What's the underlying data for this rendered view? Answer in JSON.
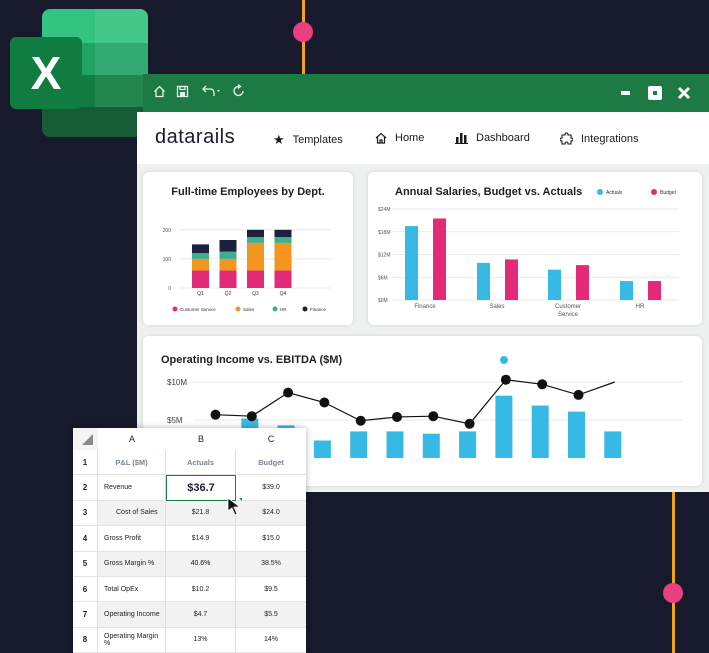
{
  "colors": {
    "background": "#171a2b",
    "accent_orange": "#f0a11f",
    "accent_pink": "#e83e82",
    "excel_green": "#1d7a45",
    "actuals_blue": "#36b9e4",
    "budget_pink": "#e22a78"
  },
  "excel_logo": {
    "letter": "X"
  },
  "window": {
    "icons": [
      "home-icon",
      "save-icon",
      "undo-icon",
      "refresh-icon",
      "minimize-icon",
      "restore-icon",
      "close-icon"
    ]
  },
  "nav": {
    "brand": "datarails",
    "templates": "Templates",
    "home": "Home",
    "dashboard": "Dashboard",
    "integrations": "Integrations"
  },
  "chart_data": [
    {
      "type": "bar",
      "stacked": true,
      "title": "Full-time Employees by Dept.",
      "categories": [
        "Q1",
        "Q2",
        "Q3",
        "Q4"
      ],
      "yticks": [
        "200",
        "100",
        "0"
      ],
      "ylim": [
        0,
        220
      ],
      "series": [
        {
          "name": "Customer Service",
          "color": "#e22a78",
          "values": [
            60,
            60,
            60,
            60
          ]
        },
        {
          "name": "Sales",
          "color": "#f3951f",
          "values": [
            40,
            40,
            95,
            95
          ]
        },
        {
          "name": "HR",
          "color": "#3fae8c",
          "values": [
            20,
            25,
            20,
            20
          ]
        },
        {
          "name": "Finance",
          "color": "#1c2140",
          "values": [
            30,
            40,
            25,
            25
          ]
        }
      ]
    },
    {
      "type": "bar",
      "title": "Annual Salaries, Budget vs. Actuals",
      "categories": [
        "Finance",
        "Sales",
        "Customer Service",
        "HR"
      ],
      "yticks": [
        "$24M",
        "$18M",
        "$12M",
        "$6M",
        "$0M"
      ],
      "ylim": [
        0,
        24
      ],
      "series": [
        {
          "name": "Actuals",
          "color": "#36b9e4",
          "values": [
            19.5,
            9.8,
            8,
            5
          ]
        },
        {
          "name": "Budget",
          "color": "#e22a78",
          "values": [
            21.5,
            10.7,
            9.2,
            5
          ]
        }
      ]
    },
    {
      "type": "bar+line",
      "title": "Operating Income vs. EBITDA ($M)",
      "yticks": [
        "$10M",
        "$5M"
      ],
      "ylim": [
        0,
        11
      ],
      "bars": [
        2.6,
        5.2,
        4.3,
        2.3,
        3.5,
        3.5,
        3.2,
        3.5,
        8.2,
        6.9,
        6.1,
        3.5
      ],
      "line": [
        5.7,
        5.5,
        8.6,
        7.3,
        4.9,
        5.4,
        5.5,
        4.5,
        10.3,
        9.7,
        8.3,
        10
      ]
    }
  ],
  "sheet": {
    "columns": [
      "A",
      "B",
      "C"
    ],
    "header": {
      "row": "1",
      "label": "P&L ($M)",
      "actuals": "Actuals",
      "budget": "Budget"
    },
    "rows": [
      {
        "num": "2",
        "label": "Revenue",
        "actuals": "$36.7",
        "budget": "$39.0",
        "selected": true
      },
      {
        "num": "3",
        "label": "Cost of Sales",
        "actuals": "$21.8",
        "budget": "$24.0",
        "indent": true
      },
      {
        "num": "4",
        "label": "Gross Profit",
        "actuals": "$14.9",
        "budget": "$15.0"
      },
      {
        "num": "5",
        "label": "Gross Margin %",
        "actuals": "40.6%",
        "budget": "38.5%"
      },
      {
        "num": "6",
        "label": "Total OpEx",
        "actuals": "$10.2",
        "budget": "$9.5"
      },
      {
        "num": "7",
        "label": "Operating Income",
        "actuals": "$4.7",
        "budget": "$5.5"
      },
      {
        "num": "8",
        "label": "Operating Margin %",
        "actuals": "13%",
        "budget": "14%"
      }
    ]
  }
}
